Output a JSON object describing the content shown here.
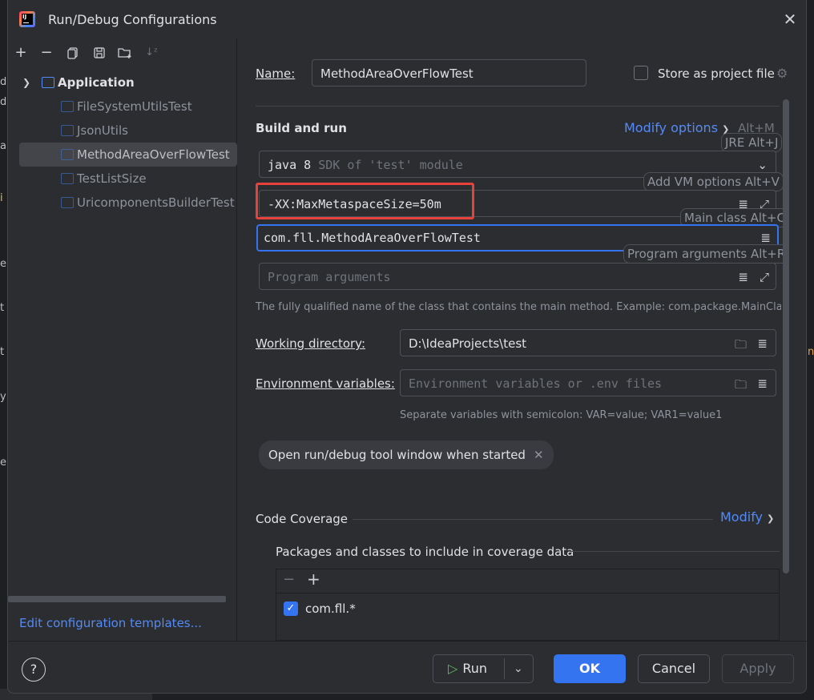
{
  "window": {
    "title": "Run/Debug Configurations",
    "close_icon": "close-icon"
  },
  "toolbar": {
    "icons": [
      "add-icon",
      "remove-icon",
      "copy-icon",
      "save-icon",
      "new-folder-icon",
      "sort-icon"
    ]
  },
  "tree": {
    "root_label": "Application",
    "items": [
      {
        "label": "FileSystemUtilsTest",
        "selected": false
      },
      {
        "label": "JsonUtils",
        "selected": false
      },
      {
        "label": "MethodAreaOverFlowTest",
        "selected": true
      },
      {
        "label": "TestListSize",
        "selected": false
      },
      {
        "label": "UricomponentsBuilderTest",
        "selected": false
      }
    ]
  },
  "edit_templates_link": "Edit configuration templates...",
  "form": {
    "name_label": "Name:",
    "name_value": "MethodAreaOverFlowTest",
    "store_label": "Store as project file",
    "store_checked": false,
    "section_build": "Build and run",
    "modify_options": "Modify options",
    "modify_shortcut": "Alt+M",
    "jre_hint": "JRE Alt+J",
    "sdk_value": "java 8",
    "sdk_detail": "SDK of 'test' module",
    "vm_hint": "Add VM options Alt+V",
    "vm_value": "-XX:MaxMetaspaceSize=50m",
    "main_hint": "Main class Alt+C",
    "main_value": "com.fll.MethodAreaOverFlowTest",
    "prog_hint": "Program arguments Alt+R",
    "prog_placeholder": "Program arguments",
    "main_class_help": "The fully qualified name of the class that contains the main method. Example: com.package.MainClass. Alt-",
    "workdir_label": "Working directory:",
    "workdir_value": "D:\\IdeaProjects\\test",
    "env_label": "Environment variables:",
    "env_placeholder": "Environment variables or .env files",
    "env_help": "Separate variables with semicolon: VAR=value; VAR1=value1",
    "chip_label": "Open run/debug tool window when started",
    "coverage_title": "Code Coverage",
    "coverage_modify": "Modify",
    "coverage_packages": "Packages and classes to include in coverage data",
    "coverage_item": "com.fll.*",
    "coverage_item_checked": true
  },
  "buttons": {
    "help": "?",
    "run": "Run",
    "ok": "OK",
    "cancel": "Cancel",
    "apply": "Apply"
  },
  "colors": {
    "accent": "#3574f0",
    "highlight_box": "#e7413b",
    "run_icon": "#5fb865"
  }
}
